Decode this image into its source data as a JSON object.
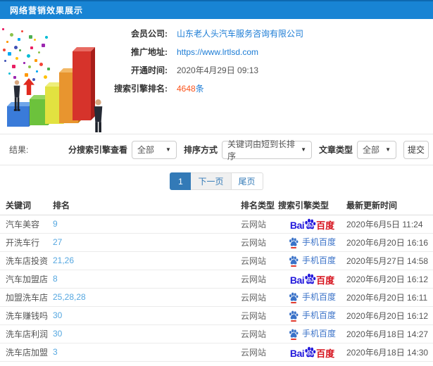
{
  "header": {
    "title": "网络营销效果展示"
  },
  "info": {
    "rows": [
      {
        "label": "会员公司:",
        "value": "山东老人头汽车服务咨询有限公司"
      },
      {
        "label": "推广地址:",
        "value": "https://www.lrtlsd.com"
      },
      {
        "label": "开通时间:",
        "value": "2020年4月29日 09:13"
      },
      {
        "label": "搜索引擎排名:",
        "value": "4648",
        "suffix": "条"
      }
    ]
  },
  "filters": {
    "result_label": "结果:",
    "engine_filter_label": "分搜索引擎查看",
    "engine_filter_value": "全部",
    "sort_label": "排序方式",
    "sort_value": "关键词由短到长排序",
    "article_type_label": "文章类型",
    "article_type_value": "全部",
    "submit_label": "提交",
    "caret": "▼"
  },
  "pagination": {
    "current": "1",
    "next": "下一页",
    "last": "尾页"
  },
  "table": {
    "headers": [
      "关键词",
      "排名",
      "排名类型",
      "搜索引擎类型",
      "最新更新时间"
    ],
    "baidu_logo": {
      "prefix": "Bai",
      "du": "du",
      "suffix": "百度"
    },
    "mobile_label": "手机百度",
    "rows": [
      {
        "keyword": "汽车美容",
        "rank": "9",
        "rank_type": "云网站",
        "engine": "baidu",
        "time": "2020年6月5日 11:24"
      },
      {
        "keyword": "开洗车行",
        "rank": "27",
        "rank_type": "云网站",
        "engine": "mobile",
        "time": "2020年6月20日 16:16"
      },
      {
        "keyword": "洗车店投资",
        "rank": "21,26",
        "rank_type": "云网站",
        "engine": "mobile",
        "time": "2020年5月27日 14:58"
      },
      {
        "keyword": "汽车加盟店",
        "rank": "8",
        "rank_type": "云网站",
        "engine": "baidu",
        "time": "2020年6月20日 16:12"
      },
      {
        "keyword": "加盟洗车店",
        "rank": "25,28,28",
        "rank_type": "云网站",
        "engine": "mobile",
        "time": "2020年6月20日 16:11"
      },
      {
        "keyword": "洗车赚钱吗",
        "rank": "30",
        "rank_type": "云网站",
        "engine": "mobile",
        "time": "2020年6月20日 16:12"
      },
      {
        "keyword": "洗车店利润",
        "rank": "30",
        "rank_type": "云网站",
        "engine": "mobile",
        "time": "2020年6月18日 14:27"
      },
      {
        "keyword": "洗车店加盟",
        "rank": "3",
        "rank_type": "云网站",
        "engine": "baidu",
        "time": "2020年6月18日 14:30"
      }
    ]
  },
  "colors": {
    "header_bg": "#1884d4",
    "accent_blue": "#337ab7",
    "link_blue": "#1c7cd5",
    "rank_blue": "#55a7e0",
    "count_orange": "#fa541c",
    "baidu_blue": "#2319dc",
    "baidu_red": "#d6101b",
    "mobile_blue": "#3a72c8"
  }
}
